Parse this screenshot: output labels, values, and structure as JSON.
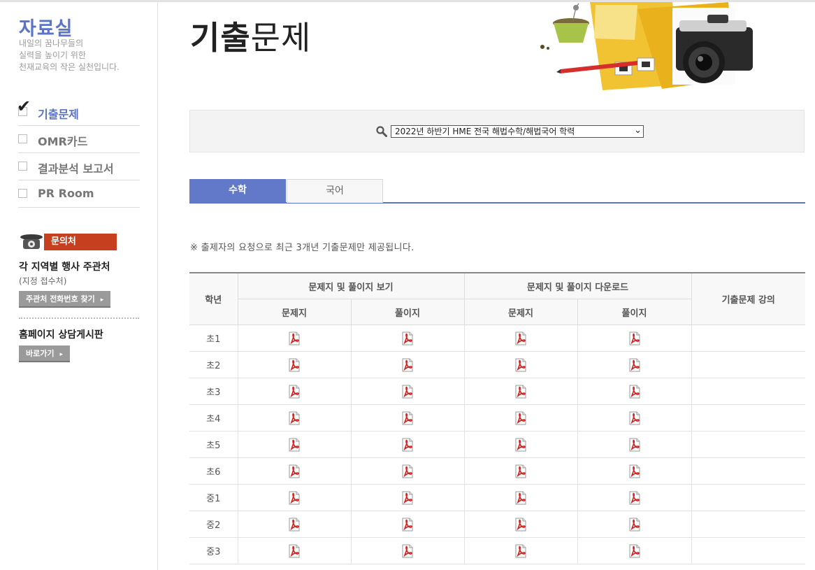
{
  "sidebar": {
    "title": "자료실",
    "desc": [
      "내일의 꿈나무들의",
      "실력을 높이기 위한",
      "천재교육의 작은 실천입니다."
    ],
    "menu": [
      {
        "label": "기출문제",
        "active": true
      },
      {
        "label": "OMR카드",
        "active": false
      },
      {
        "label": "결과분석 보고서",
        "active": false
      },
      {
        "label": "PR Room",
        "active": false
      }
    ],
    "contact": {
      "badge": "문의처",
      "title": "각 지역별 행사 주관처",
      "sub": "(지정 접수처)",
      "btn": "주관처 전화번호 찾기",
      "arrow": "▸",
      "title2": "홈페이지 상담게시판",
      "btn2": "바로가기"
    }
  },
  "header": {
    "title_bold": "기출",
    "title_rest": "문제"
  },
  "search": {
    "selected": "2022년 하반기 HME 전국 해법수학/해법국어 학력",
    "chevron": "⌄"
  },
  "tabs": [
    {
      "label": "수학",
      "active": true
    },
    {
      "label": "국어",
      "active": false
    }
  ],
  "notice": "※ 출제자의 요청으로 최근 3개년 기출문제만 제공됩니다.",
  "table": {
    "col_grade": "학년",
    "group_view": "문제지 및 풀이지 보기",
    "group_download": "문제지 및 풀이지 다운로드",
    "col_lecture": "기출문제 강의",
    "sub_problem": "문제지",
    "sub_solution": "풀이지",
    "rows": [
      "초1",
      "초2",
      "초3",
      "초4",
      "초5",
      "초6",
      "중1",
      "중2",
      "중3"
    ]
  },
  "colors": {
    "accent": "#6278c8",
    "badge": "#c6401f",
    "pdf_red": "#d21f1f"
  }
}
